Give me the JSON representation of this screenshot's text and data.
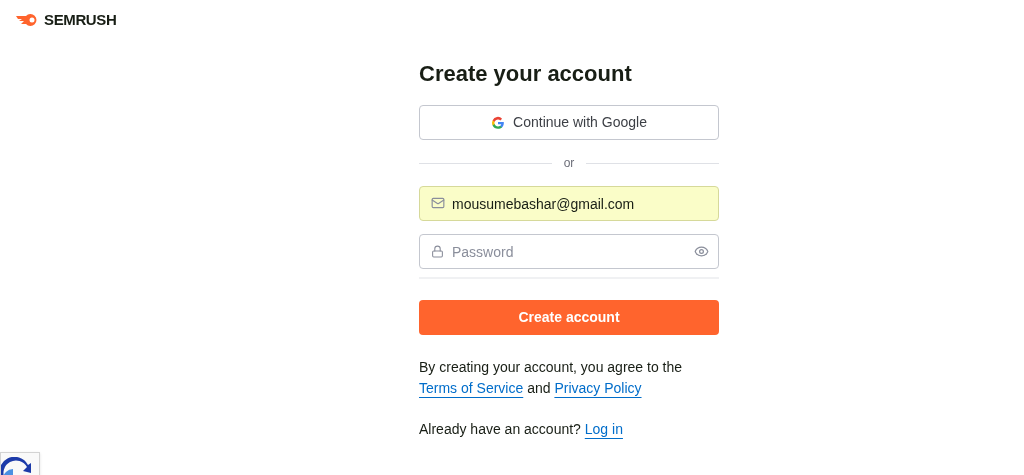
{
  "logo": {
    "text": "SEMRUSH"
  },
  "title": "Create your account",
  "google_button": {
    "label": "Continue with Google"
  },
  "divider": "or",
  "email_field": {
    "value": "mousumebashar@gmail.com",
    "autofilled": true
  },
  "password_field": {
    "placeholder": "Password"
  },
  "submit_button": {
    "label": "Create account"
  },
  "terms": {
    "text": "By creating your account, you agree to the",
    "link_1": "Terms of Service",
    "joiner": "and",
    "link_2": "Privacy Policy"
  },
  "login": {
    "text": "Already have an account?",
    "link": "Log in"
  }
}
